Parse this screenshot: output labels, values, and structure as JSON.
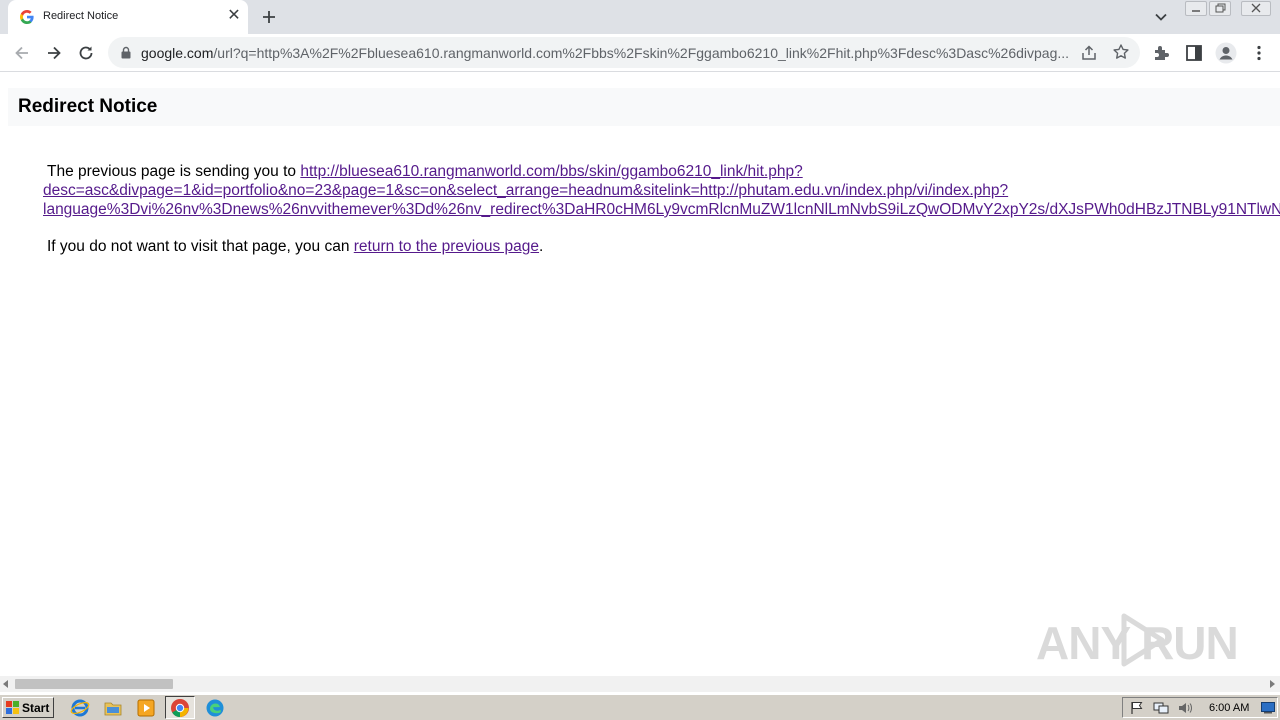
{
  "browser": {
    "tab": {
      "title": "Redirect Notice",
      "close_glyph": "✕"
    },
    "new_tab_label": "+",
    "address_bar": {
      "host": "google.com",
      "rest": "/url?q=http%3A%2F%2Fbluesea610.rangmanworld.com%2Fbbs%2Fskin%2Fggambo6210_link%2Fhit.php%3Fdesc%3Dasc%26divpag..."
    }
  },
  "page": {
    "title": "Redirect Notice",
    "sending_prefix": "The previous page is sending you to",
    "redirect_url_lines": [
      "http://bluesea610.rangmanworld.com/bbs/skin/ggambo6210_link/hit.php?",
      "desc=asc&divpage=1&id=portfolio&no=23&page=1&sc=on&select_arrange=headnum&sitelink=http://phutam.edu.vn/index.php/vi/index.php?",
      "language%3Dvi%26nv%3Dnews%26nvvithemever%3Dd%26nv_redirect%3DaHR0cHM6Ly9vcmRlcnMuZW1lcnNlLmNvbS9iLzQwODMvY2xpY2s/dXJsPWh0dHBzJTNBLy91NTlwN"
    ],
    "return_prefix": "If you do not want to visit that page, you can",
    "return_link": "return to the previous page",
    "return_suffix": "."
  },
  "watermark": {
    "text": "ANY RUN"
  },
  "taskbar": {
    "start_label": "Start",
    "clock": "6:00 AM"
  },
  "colors": {
    "tabstrip": "#dee1e6",
    "link_visited": "#551a8b",
    "taskbar": "#d4d0c8"
  }
}
